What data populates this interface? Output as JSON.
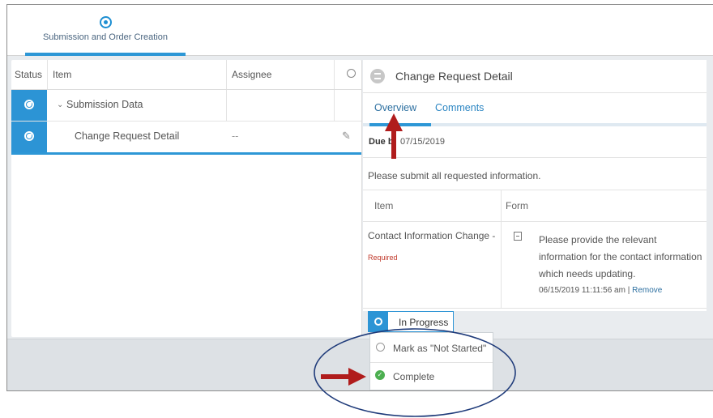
{
  "top_tab": {
    "label": "Submission and Order Creation"
  },
  "left_table": {
    "headers": {
      "status": "Status",
      "item": "Item",
      "assignee": "Assignee"
    },
    "rows": [
      {
        "item": "Submission Data",
        "chevron": "⌄",
        "assignee": ""
      },
      {
        "item": "Change Request Detail",
        "assignee": "--"
      }
    ]
  },
  "detail": {
    "title": "Change Request Detail",
    "tabs": [
      "Overview",
      "Comments"
    ],
    "due_label": "Due b",
    "due_date": "07/15/2019",
    "message": "Please submit all requested information.",
    "table_headers": {
      "item": "Item",
      "form": "Form"
    },
    "row": {
      "item": "Contact Information Change -",
      "required": "Required",
      "form_text": "Please provide the relevant information for the contact information which needs updating.",
      "timestamp": "06/15/2019 11:11:56 am",
      "separator": "|",
      "remove": "Remove"
    }
  },
  "status_dropdown": {
    "current": "In Progress",
    "options": [
      "Mark as \"Not Started\"",
      "Complete"
    ]
  },
  "colors": {
    "accent": "#2c94d5",
    "annotation_red": "#b01c1c",
    "annotation_ellipse": "#1f3b7a",
    "success": "#4caf50"
  }
}
